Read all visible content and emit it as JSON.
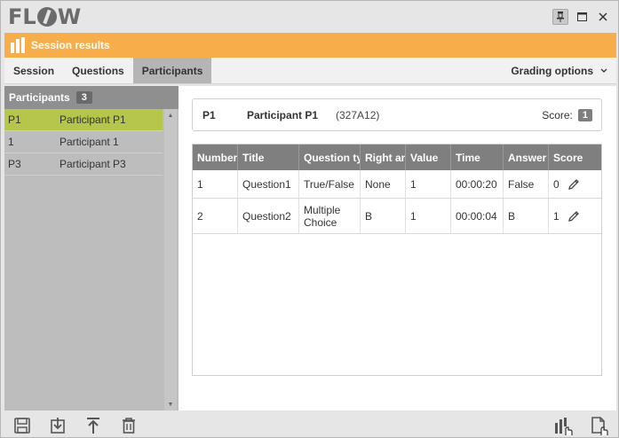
{
  "app": {
    "logo": "FLOW"
  },
  "header": {
    "title": "Session results"
  },
  "tabs": [
    {
      "label": "Session"
    },
    {
      "label": "Questions"
    },
    {
      "label": "Participants"
    }
  ],
  "grading_options": {
    "label": "Grading options"
  },
  "participants_panel": {
    "title": "Participants",
    "count": "3",
    "items": [
      {
        "id": "P1",
        "name": "Participant P1"
      },
      {
        "id": "1",
        "name": "Participant 1"
      },
      {
        "id": "P3",
        "name": "Participant P3"
      }
    ]
  },
  "selected": {
    "id": "P1",
    "name": "Participant P1",
    "code": "(327A12)",
    "score_label": "Score:",
    "score": "1"
  },
  "table": {
    "headers": [
      "Number",
      "Title",
      "Question ty",
      "Right an",
      "Value",
      "Time",
      "Answer",
      "Score"
    ],
    "rows": [
      {
        "number": "1",
        "title": "Question1",
        "type": "True/False",
        "right": "None",
        "value": "1",
        "time": "00:00:20",
        "answer": "False",
        "score": "0"
      },
      {
        "number": "2",
        "title": "Question2",
        "type": "Multiple Choice",
        "right": "B",
        "value": "1",
        "time": "00:00:04",
        "answer": "B",
        "score": "1"
      }
    ]
  },
  "colors": {
    "accent": "#f7ae4a",
    "selected_row": "#b5c64a",
    "table_header": "#7f7f7f"
  },
  "icons": {
    "window": [
      "pin-icon",
      "maximize-icon",
      "close-icon"
    ],
    "bottom_left": [
      "save-icon",
      "import-icon",
      "export-icon",
      "delete-icon"
    ],
    "bottom_right": [
      "chart-icon",
      "report-icon"
    ]
  }
}
